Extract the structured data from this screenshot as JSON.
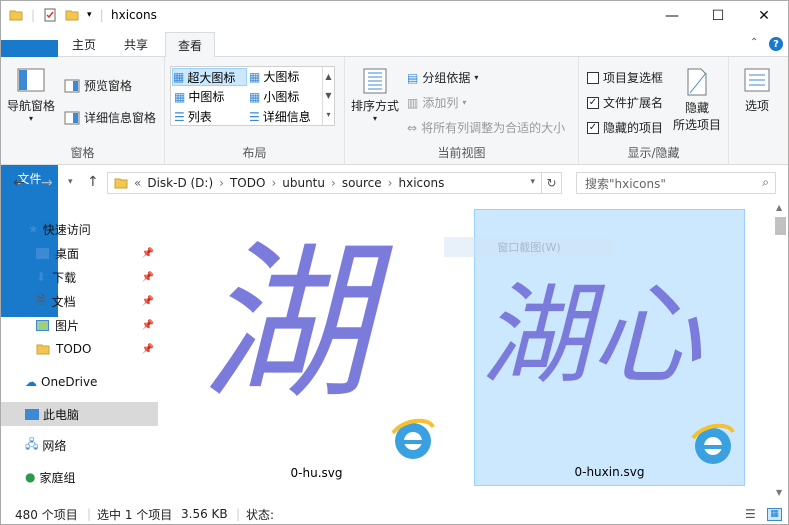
{
  "window": {
    "title": "hxicons",
    "minimize": "—",
    "maximize": "☐",
    "close": "✕"
  },
  "tabs": [
    {
      "label": "文件"
    },
    {
      "label": "主页"
    },
    {
      "label": "共享"
    },
    {
      "label": "查看"
    }
  ],
  "ribbon": {
    "panes": {
      "label": "窗格",
      "nav_pane": "导航窗格",
      "preview_pane": "预览窗格",
      "details_pane": "详细信息窗格"
    },
    "layout": {
      "label": "布局",
      "items": [
        "超大图标",
        "大图标",
        "中图标",
        "小图标",
        "列表",
        "详细信息"
      ]
    },
    "current_view": {
      "label": "当前视图",
      "sort": "排序方式",
      "group": "分组依据",
      "add_col": "添加列",
      "fit_cols": "将所有列调整为合适的大小"
    },
    "show_hide": {
      "label": "显示/隐藏",
      "item_checkbox": "项目复选框",
      "extensions": "文件扩展名",
      "hidden": "隐藏的项目",
      "hide_selected_1": "隐藏",
      "hide_selected_2": "所选项目",
      "item_checkbox_checked": false,
      "extensions_checked": true,
      "hidden_checked": true
    },
    "options": {
      "label": "选项"
    }
  },
  "address": {
    "crumbs": [
      "Disk-D (D:)",
      "TODO",
      "ubuntu",
      "source",
      "hxicons"
    ],
    "search_placeholder": "搜索\"hxicons\""
  },
  "nav": {
    "quick": "快速访问",
    "items": [
      "桌面",
      "下载",
      "文档",
      "图片",
      "TODO"
    ],
    "onedrive": "OneDrive",
    "thispc": "此电脑",
    "network": "网络",
    "homegroup": "家庭组"
  },
  "files": [
    {
      "name": "0-hu.svg",
      "glyph": "湖"
    },
    {
      "name": "0-huxin.svg",
      "glyph": "湖心"
    }
  ],
  "tooltip": "窗口截图(W)",
  "status": {
    "count": "480 个项目",
    "selected": "选中 1 个项目",
    "size": "3.56 KB",
    "state": "状态:"
  },
  "colors": {
    "accent": "#1979ca",
    "glyph": "#7b7bdc",
    "select": "#cce8ff"
  }
}
